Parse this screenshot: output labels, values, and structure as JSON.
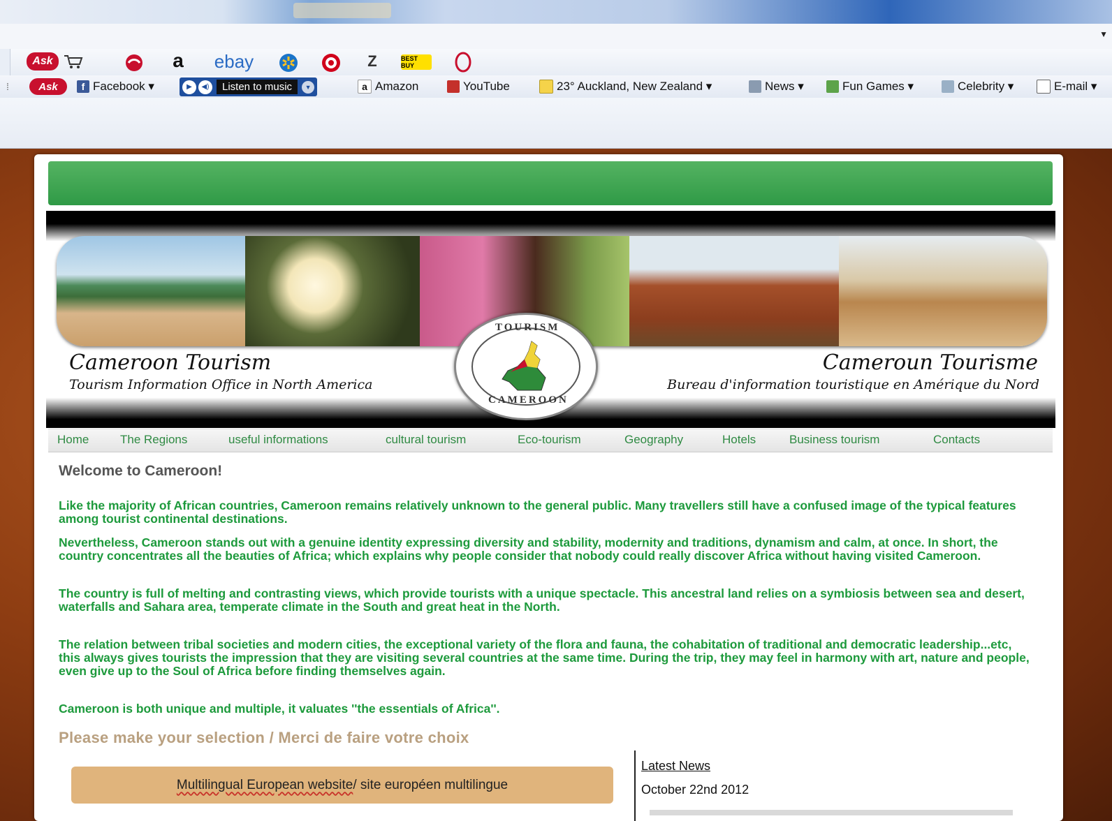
{
  "toolbar": {
    "ask_label": "Ask",
    "site_icons": [
      "amazon-a",
      "ebay",
      "walmart",
      "target",
      "zappos",
      "best-buy",
      "opera"
    ],
    "ebay_label": "ebay",
    "amazon_a": "a",
    "bestbuy_label": "BEST BUY"
  },
  "favorites": {
    "ask_label": "Ask",
    "facebook": "Facebook ▾",
    "listen_music": "Listen to music",
    "amazon": "Amazon",
    "youtube": "YouTube",
    "weather": "23° Auckland, New Zealand ▾",
    "news": "News ▾",
    "fun_games": "Fun Games ▾",
    "celebrity": "Celebrity ▾",
    "email": "E-mail ▾"
  },
  "banner": {
    "title_en": "Cameroon Tourism",
    "subtitle_en": "Tourism Information Office in North America",
    "title_fr": "Cameroun Tourisme",
    "subtitle_fr": "Bureau d'information touristique en Amérique du Nord",
    "logo_top": "TOURISM",
    "logo_bottom": "CAMEROON"
  },
  "nav": {
    "items": [
      "Home",
      "The Regions",
      "useful informations",
      "cultural tourism",
      "Eco-tourism",
      "Geography",
      "Hotels",
      "Business tourism",
      "Contacts"
    ]
  },
  "content": {
    "welcome": "Welcome to Cameroon!",
    "p1": "Like the majority of African countries, Cameroon remains relatively unknown to the general public. Many travellers still have a confused image of the typical features among tourist continental destinations.",
    "p2": "Nevertheless, Cameroon stands out with a genuine identity expressing diversity and stability, modernity and traditions, dynamism and calm, at once. In short, the country concentrates all the beauties of Africa; which explains why people consider that nobody could really discover Africa without having visited Cameroon.",
    "p3": "The country is full of melting and contrasting views, which provide tourists with a unique spectacle. This ancestral land relies on a symbiosis between sea and desert, waterfalls and Sahara area, temperate climate in the South and great heat in the North.",
    "p4": "The relation between tribal societies and modern cities, the exceptional variety of the flora and fauna, the cohabitation of traditional and democratic leadership...etc, this always gives tourists the impression that they are visiting several countries at the same time. During the trip, they may feel in harmony with art, nature and people, even give up to the Soul of Africa before finding themselves again.",
    "p5": "Cameroon is both unique and multiple, it valuates ''the essentials of Africa''.",
    "selection": "Please make your selection / Merci de faire votre choix",
    "multi_a": "Multilingual European website",
    "multi_b": " / site européen multilingue"
  },
  "news": {
    "heading": "Latest News",
    "date": "October 22nd 2012"
  },
  "colors": {
    "accent_green": "#2f9a46",
    "text_green": "#1d9a3c",
    "button_tan": "#e0b47c",
    "selection_tan": "#b9a080"
  }
}
